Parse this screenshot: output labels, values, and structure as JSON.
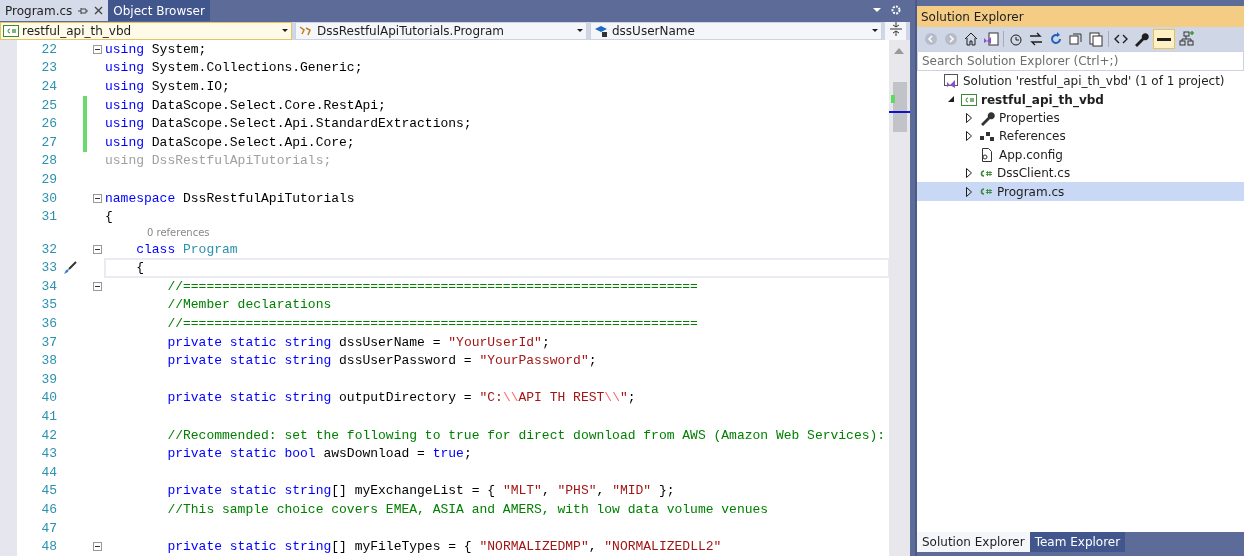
{
  "document_tabs": [
    {
      "label": "Program.cs",
      "selected": true
    },
    {
      "label": "Object Browser",
      "selected": false
    }
  ],
  "nav_bar": {
    "project": "restful_api_th_vbd",
    "type": "DssRestfulApiTutorials.Program",
    "member": "dssUserName"
  },
  "editor": {
    "lines": [
      {
        "kind": "code",
        "number": "22",
        "fold": true,
        "changed": false,
        "current": false,
        "tokens": [
          {
            "kind": "kw",
            "text": "using"
          },
          {
            "kind": "plain",
            "text": " System;"
          }
        ]
      },
      {
        "kind": "code",
        "number": "23",
        "fold": false,
        "changed": false,
        "current": false,
        "tokens": [
          {
            "kind": "kw",
            "text": "using"
          },
          {
            "kind": "plain",
            "text": " System.Collections.Generic;"
          }
        ]
      },
      {
        "kind": "code",
        "number": "24",
        "fold": false,
        "changed": false,
        "current": false,
        "tokens": [
          {
            "kind": "kw",
            "text": "using"
          },
          {
            "kind": "plain",
            "text": " System.IO;"
          }
        ]
      },
      {
        "kind": "code",
        "number": "25",
        "fold": false,
        "changed": true,
        "current": false,
        "tokens": [
          {
            "kind": "kw",
            "text": "using"
          },
          {
            "kind": "plain",
            "text": " DataScope.Select.Core.RestApi;"
          }
        ]
      },
      {
        "kind": "code",
        "number": "26",
        "fold": false,
        "changed": true,
        "current": false,
        "tokens": [
          {
            "kind": "kw",
            "text": "using"
          },
          {
            "kind": "plain",
            "text": " DataScope.Select.Api.StandardExtractions;"
          }
        ]
      },
      {
        "kind": "code",
        "number": "27",
        "fold": false,
        "changed": true,
        "current": false,
        "tokens": [
          {
            "kind": "kw",
            "text": "using"
          },
          {
            "kind": "plain",
            "text": " DataScope.Select.Api.Core;"
          }
        ]
      },
      {
        "kind": "code",
        "number": "28",
        "fold": false,
        "changed": false,
        "current": false,
        "tokens": [
          {
            "kind": "faded",
            "text": "using DssRestfulApiTutorials;"
          }
        ]
      },
      {
        "kind": "code",
        "number": "29",
        "fold": false,
        "changed": false,
        "current": false
      },
      {
        "kind": "code",
        "number": "30",
        "fold": true,
        "changed": false,
        "current": false,
        "tokens": [
          {
            "kind": "kw",
            "text": "namespace"
          },
          {
            "kind": "plain",
            "text": " DssRestfulApiTutorials"
          }
        ]
      },
      {
        "kind": "code",
        "number": "31",
        "fold": false,
        "changed": false,
        "current": false,
        "tokens": [
          {
            "kind": "plain",
            "text": "{"
          }
        ]
      },
      {
        "kind": "codelens",
        "text": "0 references"
      },
      {
        "kind": "code",
        "number": "32",
        "fold": true,
        "changed": false,
        "current": false,
        "tokens": [
          {
            "kind": "kw",
            "text": "    class "
          },
          {
            "kind": "type",
            "text": "Program"
          }
        ]
      },
      {
        "kind": "code",
        "number": "33",
        "fold": false,
        "changed": false,
        "current": true,
        "tokens": [
          {
            "kind": "plain",
            "text": "    {"
          }
        ]
      },
      {
        "kind": "code",
        "number": "34",
        "fold": true,
        "changed": false,
        "current": false,
        "tokens": [
          {
            "kind": "comment",
            "text": "        //=================================================================="
          }
        ]
      },
      {
        "kind": "code",
        "number": "35",
        "fold": false,
        "changed": false,
        "current": false,
        "tokens": [
          {
            "kind": "comment",
            "text": "        //Member declarations"
          }
        ]
      },
      {
        "kind": "code",
        "number": "36",
        "fold": false,
        "changed": false,
        "current": false,
        "tokens": [
          {
            "kind": "comment",
            "text": "        //=================================================================="
          }
        ]
      },
      {
        "kind": "code",
        "number": "37",
        "fold": false,
        "changed": false,
        "current": false,
        "tokens": [
          {
            "kind": "kw",
            "text": "        private static string"
          },
          {
            "kind": "plain",
            "text": " dssUserName = "
          },
          {
            "kind": "str",
            "text": "\"YourUserId\""
          },
          {
            "kind": "plain",
            "text": ";"
          }
        ]
      },
      {
        "kind": "code",
        "number": "38",
        "fold": false,
        "changed": false,
        "current": false,
        "tokens": [
          {
            "kind": "kw",
            "text": "        private static string"
          },
          {
            "kind": "plain",
            "text": " dssUserPassword = "
          },
          {
            "kind": "str",
            "text": "\"YourPassword\""
          },
          {
            "kind": "plain",
            "text": ";"
          }
        ]
      },
      {
        "kind": "code",
        "number": "39",
        "fold": false,
        "changed": false,
        "current": false
      },
      {
        "kind": "code",
        "number": "40",
        "fold": false,
        "changed": false,
        "current": false,
        "tokens": [
          {
            "kind": "kw",
            "text": "        private static string"
          },
          {
            "kind": "plain",
            "text": " outputDirectory = "
          },
          {
            "kind": "str",
            "text": "\"C:"
          },
          {
            "kind": "esc",
            "text": "\\\\"
          },
          {
            "kind": "str",
            "text": "API TH REST"
          },
          {
            "kind": "esc",
            "text": "\\\\"
          },
          {
            "kind": "str",
            "text": "\""
          },
          {
            "kind": "plain",
            "text": ";"
          }
        ]
      },
      {
        "kind": "code",
        "number": "41",
        "fold": false,
        "changed": false,
        "current": false
      },
      {
        "kind": "code",
        "number": "42",
        "fold": false,
        "changed": false,
        "current": false,
        "tokens": [
          {
            "kind": "comment",
            "text": "        //Recommended: set the following to true for direct download from AWS (Amazon Web Services):"
          }
        ]
      },
      {
        "kind": "code",
        "number": "43",
        "fold": false,
        "changed": false,
        "current": false,
        "tokens": [
          {
            "kind": "kw",
            "text": "        private static bool"
          },
          {
            "kind": "plain",
            "text": " awsDownload = "
          },
          {
            "kind": "kw",
            "text": "true"
          },
          {
            "kind": "plain",
            "text": ";"
          }
        ]
      },
      {
        "kind": "code",
        "number": "44",
        "fold": false,
        "changed": false,
        "current": false
      },
      {
        "kind": "code",
        "number": "45",
        "fold": false,
        "changed": false,
        "current": false,
        "tokens": [
          {
            "kind": "kw",
            "text": "        private static string"
          },
          {
            "kind": "plain",
            "text": "[] myExchangeList = { "
          },
          {
            "kind": "str",
            "text": "\"MLT\""
          },
          {
            "kind": "plain",
            "text": ", "
          },
          {
            "kind": "str",
            "text": "\"PHS\""
          },
          {
            "kind": "plain",
            "text": ", "
          },
          {
            "kind": "str",
            "text": "\"MID\""
          },
          {
            "kind": "plain",
            "text": " };"
          }
        ]
      },
      {
        "kind": "code",
        "number": "46",
        "fold": false,
        "changed": false,
        "current": false,
        "tokens": [
          {
            "kind": "comment",
            "text": "        //This sample choice covers EMEA, ASIA and AMERS, with low data volume venues"
          }
        ]
      },
      {
        "kind": "code",
        "number": "47",
        "fold": false,
        "changed": false,
        "current": false
      },
      {
        "kind": "code",
        "number": "48",
        "fold": true,
        "changed": false,
        "current": false,
        "tokens": [
          {
            "kind": "kw",
            "text": "        private static string"
          },
          {
            "kind": "plain",
            "text": "[] myFileTypes = { "
          },
          {
            "kind": "str",
            "text": "\"NORMALIZEDMP\""
          },
          {
            "kind": "plain",
            "text": ", "
          },
          {
            "kind": "str",
            "text": "\"NORMALIZEDLL2\""
          }
        ]
      }
    ]
  },
  "solution_explorer": {
    "title": "Solution Explorer",
    "search": {
      "placeholder": "Search Solution Explorer (Ctrl+;)"
    },
    "tree": [
      {
        "kind": "solution",
        "label": "Solution 'restful_api_th_vbd' (1 of 1 project)",
        "selected": false,
        "children": [
          {
            "kind": "project",
            "label": "restful_api_th_vbd",
            "expanded": true,
            "selected": false,
            "children": [
              {
                "kind": "properties",
                "label": "Properties",
                "expanded": false,
                "selected": false
              },
              {
                "kind": "references",
                "label": "References",
                "expanded": false,
                "selected": false
              },
              {
                "kind": "config",
                "label": "App.config",
                "selected": false
              },
              {
                "kind": "csfile",
                "label": "DssClient.cs",
                "expanded": false,
                "selected": false
              },
              {
                "kind": "csfile",
                "label": "Program.cs",
                "expanded": false,
                "selected": true
              }
            ]
          }
        ]
      }
    ],
    "bottom_tabs": [
      {
        "label": "Solution Explorer",
        "selected": true
      },
      {
        "label": "Team Explorer",
        "selected": false
      }
    ]
  }
}
